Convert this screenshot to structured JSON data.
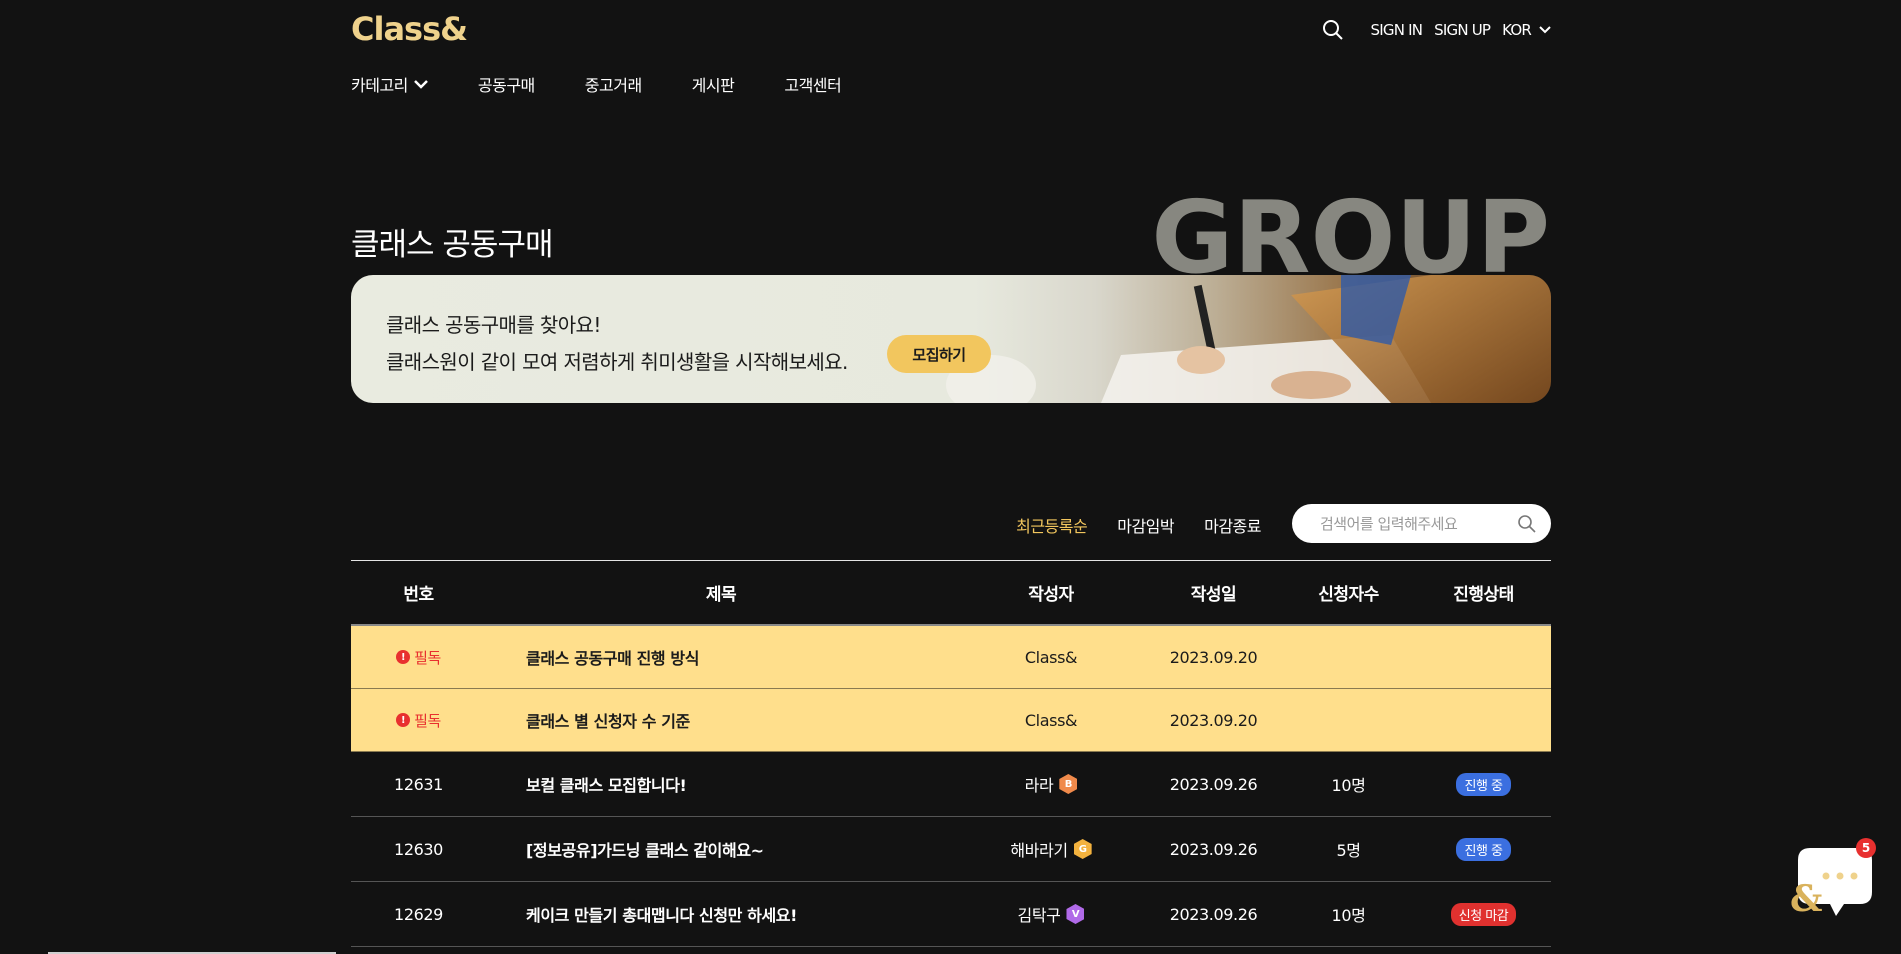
{
  "header": {
    "logo": "Class&",
    "sign_in": "SIGN IN",
    "sign_up": "SIGN UP",
    "language": "KOR"
  },
  "nav": {
    "items": [
      {
        "label": "카테고리"
      },
      {
        "label": "공동구매"
      },
      {
        "label": "중고거래"
      },
      {
        "label": "게시판"
      },
      {
        "label": "고객센터"
      }
    ]
  },
  "hero": {
    "title": "클래스 공동구매",
    "bg_word": "GROUP",
    "banner_heading": "클래스 공동구매를 찾아요!",
    "banner_text": "클래스원이 같이 모여 저렴하게 취미생활을 시작해보세요.",
    "recruit_button": "모집하기"
  },
  "filters": {
    "sort_options": [
      "최근등록순",
      "마감임박",
      "마감종료"
    ],
    "active_sort": "최근등록순",
    "search_placeholder": "검색어를 입력해주세요"
  },
  "table": {
    "headers": {
      "no": "번호",
      "title": "제목",
      "author": "작성자",
      "date": "작성일",
      "count": "신청자수",
      "status": "진행상태"
    },
    "notices": [
      {
        "tag": "필독",
        "title": "클래스 공동구매 진행 방식",
        "author": "Class&",
        "date": "2023.09.20"
      },
      {
        "tag": "필독",
        "title": "클래스 별 신청자 수 기준",
        "author": "Class&",
        "date": "2023.09.20"
      }
    ],
    "rows": [
      {
        "no": "12631",
        "title": "보컬 클래스 모집합니다!",
        "author": "라라",
        "level": "B",
        "level_color": "#f08a4b",
        "date": "2023.09.26",
        "count": "10명",
        "status": "진행 중",
        "status_color": "#3b6fe0"
      },
      {
        "no": "12630",
        "title": "[정보공유]가드닝 클래스 같이해요~",
        "author": "해바라기",
        "level": "G",
        "level_color": "#f3b23e",
        "date": "2023.09.26",
        "count": "5명",
        "status": "진행 중",
        "status_color": "#3b6fe0"
      },
      {
        "no": "12629",
        "title": "케이크 만들기 총대맵니다 신청만 하세요!",
        "author": "김탁구",
        "level": "V",
        "level_color": "#b06ae8",
        "date": "2023.09.26",
        "count": "10명",
        "status": "신청 마감",
        "status_color": "#e0312f"
      }
    ]
  },
  "chat": {
    "badge_count": "5",
    "icon_text": "&"
  },
  "colors": {
    "accent": "#f2c65e",
    "logo": "#efd28c",
    "notice_bg": "#ffdf8c",
    "background": "#121212"
  }
}
